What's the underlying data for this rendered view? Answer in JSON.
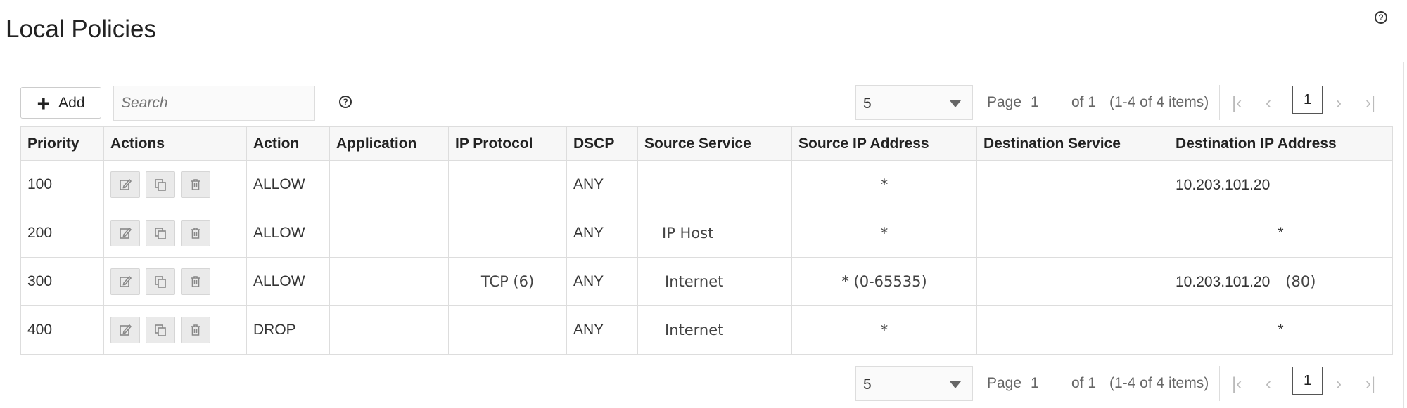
{
  "page": {
    "title": "Local Policies"
  },
  "toolbar": {
    "add_label": "Add",
    "search_placeholder": "Search"
  },
  "pager": {
    "page_size": "5",
    "page_label": "Page",
    "page_number": "1",
    "of_label": "of 1",
    "items_label": "(1-4 of 4 items)",
    "current_page": "1"
  },
  "table": {
    "headers": [
      "Priority",
      "Actions",
      "Action",
      "Application",
      "IP Protocol",
      "DSCP",
      "Source Service",
      "Source IP Address",
      "Destination Service",
      "Destination IP Address"
    ],
    "rows": [
      {
        "priority": "100",
        "action": "ALLOW",
        "application": "",
        "ip_protocol": "",
        "dscp": "ANY",
        "source_service": "",
        "source_ip": "*",
        "destination_service": "",
        "destination_ip": "10.203.101.20",
        "destination_port": ""
      },
      {
        "priority": "200",
        "action": "ALLOW",
        "application": "",
        "ip_protocol": "",
        "dscp": "ANY",
        "source_service": "IP Host",
        "source_ip": "*",
        "destination_service": "",
        "destination_ip": "*",
        "destination_port": ""
      },
      {
        "priority": "300",
        "action": "ALLOW",
        "application": "",
        "ip_protocol": "TCP (6)",
        "dscp": "ANY",
        "source_service": "Internet",
        "source_ip": "* (0-65535)",
        "destination_service": "",
        "destination_ip": "10.203.101.20",
        "destination_port": "(80)"
      },
      {
        "priority": "400",
        "action": "DROP",
        "application": "",
        "ip_protocol": "",
        "dscp": "ANY",
        "source_service": "Internet",
        "source_ip": "*",
        "destination_service": "",
        "destination_ip": "*",
        "destination_port": ""
      }
    ]
  },
  "icons": {
    "help": "help-icon",
    "edit": "edit-icon",
    "copy": "copy-icon",
    "delete": "trash-icon"
  }
}
